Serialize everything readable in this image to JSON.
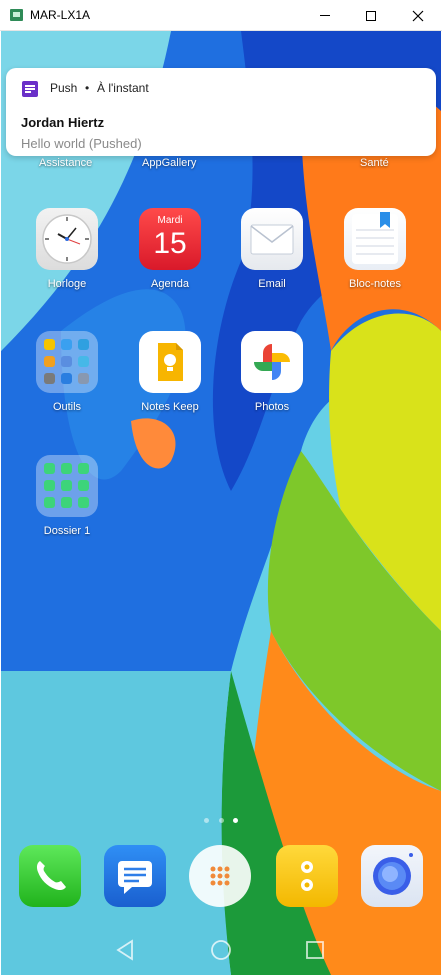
{
  "window": {
    "title": "MAR-LX1A",
    "minimize_label": "",
    "maximize_label": "",
    "close_label": "✕"
  },
  "notification": {
    "app": "Push",
    "separator": "•",
    "time": "À l'instant",
    "title": "Jordan Hiertz",
    "body": "Hello world (Pushed)",
    "icon": "chat-bubble-icon",
    "icon_color": "#6a30c8"
  },
  "partial_row": [
    "Assistance",
    "AppGallery",
    "Santé"
  ],
  "apps": [
    {
      "label": "Horloge",
      "icon": "clock-icon"
    },
    {
      "label": "Agenda",
      "icon": "calendar-icon",
      "day": "Mardi",
      "date": "15"
    },
    {
      "label": "Email",
      "icon": "mail-icon"
    },
    {
      "label": "Bloc-notes",
      "icon": "notepad-icon"
    },
    {
      "label": "Outils",
      "icon": "tools-folder-icon"
    },
    {
      "label": "Notes Keep",
      "icon": "keep-icon"
    },
    {
      "label": "Photos",
      "icon": "photos-icon"
    },
    {
      "label": "Dossier 1",
      "icon": "folder-icon"
    }
  ],
  "page_indicator": {
    "pages": 3,
    "active": 3
  },
  "dock": [
    {
      "name": "phone",
      "icon": "phone-icon"
    },
    {
      "name": "messages",
      "icon": "messages-icon"
    },
    {
      "name": "app-drawer",
      "icon": "app-drawer-icon"
    },
    {
      "name": "notes",
      "icon": "notes-icon"
    },
    {
      "name": "browser",
      "icon": "browser-icon"
    }
  ],
  "navbar": [
    "back-icon",
    "home-icon",
    "recents-icon"
  ]
}
